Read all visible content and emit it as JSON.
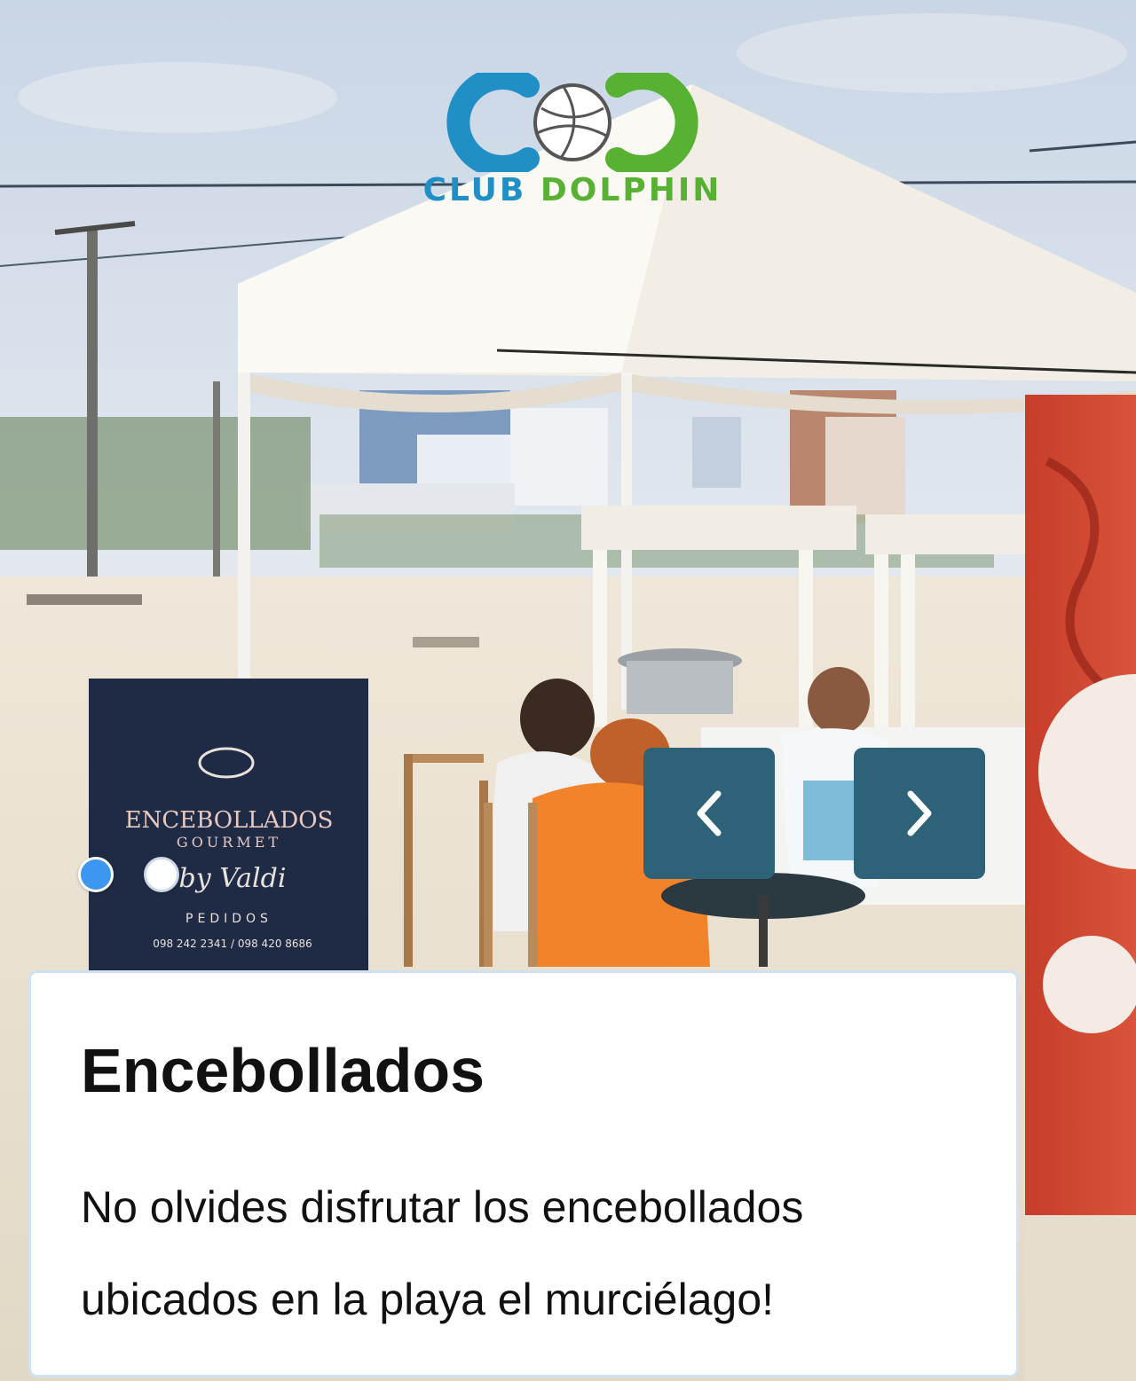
{
  "slider": {
    "logo": {
      "text_club": "CLUB",
      "text_dolphin": "DOLPHIN",
      "colors": {
        "blue": "#1f8fc6",
        "green": "#57b133"
      }
    },
    "photo": {
      "sign_text": "ENCEBOLLADOS",
      "sign_subtext": "GOURMET",
      "sign_by": "by Valdi",
      "sign_orders": "PEDIDOS",
      "sign_phone": "098 242 2341 / 098 420 8686"
    },
    "dots": [
      {
        "label": "slide 1",
        "active": true
      },
      {
        "label": "slide 2",
        "active": false
      }
    ],
    "prev_icon": "chevron-left-icon",
    "next_icon": "chevron-right-icon",
    "nav_color": "#2e6278",
    "active_dot_color": "#3d96f0"
  },
  "card": {
    "title": "Encebollados",
    "description": "No olvides disfrutar los encebollados ubicados en la playa el murciélago!"
  }
}
